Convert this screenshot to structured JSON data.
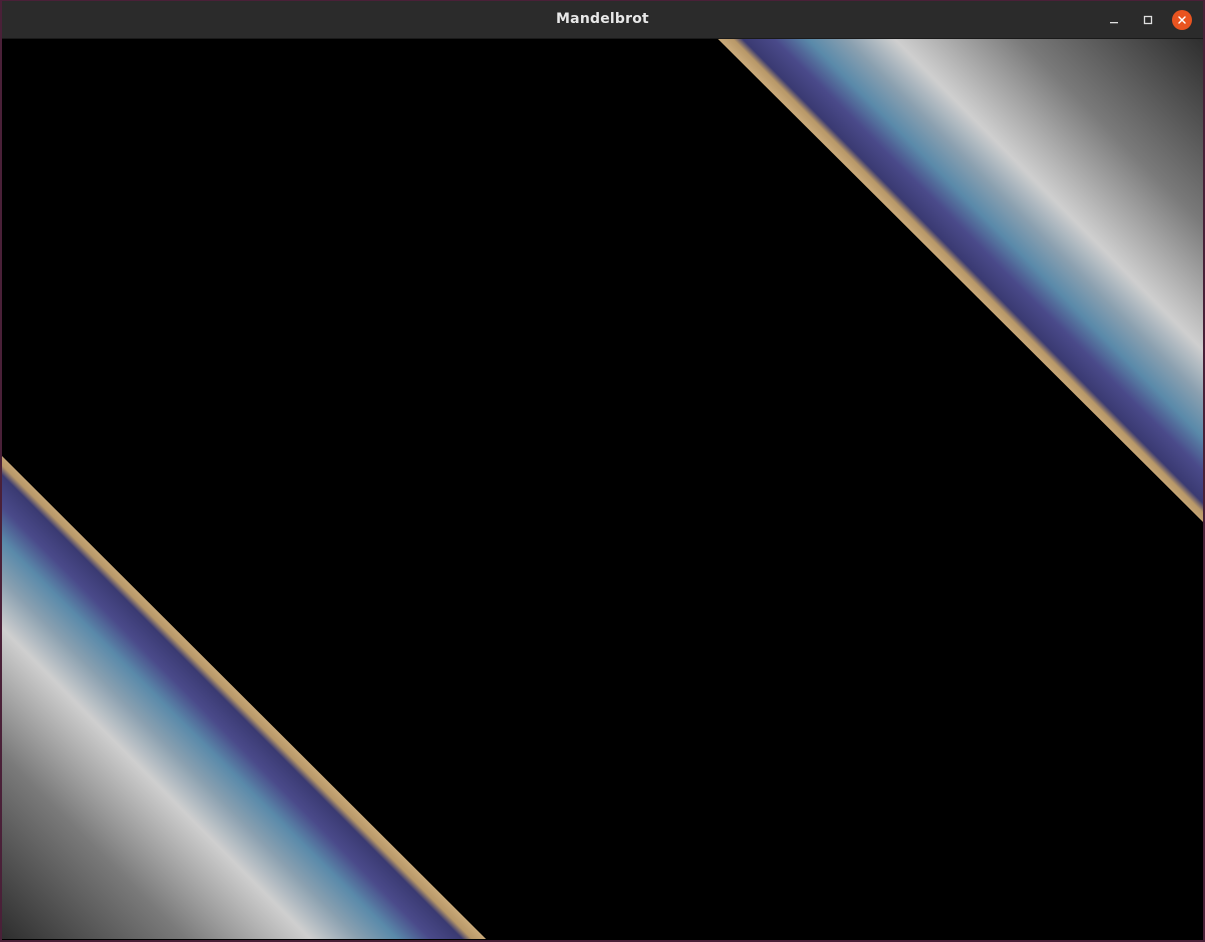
{
  "window": {
    "title": "Mandelbrot"
  },
  "controls": {
    "minimize_icon": "minimize-icon",
    "maximize_icon": "maximize-icon",
    "close_icon": "close-icon",
    "close_color": "#e95420"
  },
  "render": {
    "background_color": "#000000",
    "band_colors": [
      "#c8a878",
      "#4a4a8a",
      "#5a8aaa",
      "#cfcfcf",
      "#2e2e2e"
    ]
  }
}
